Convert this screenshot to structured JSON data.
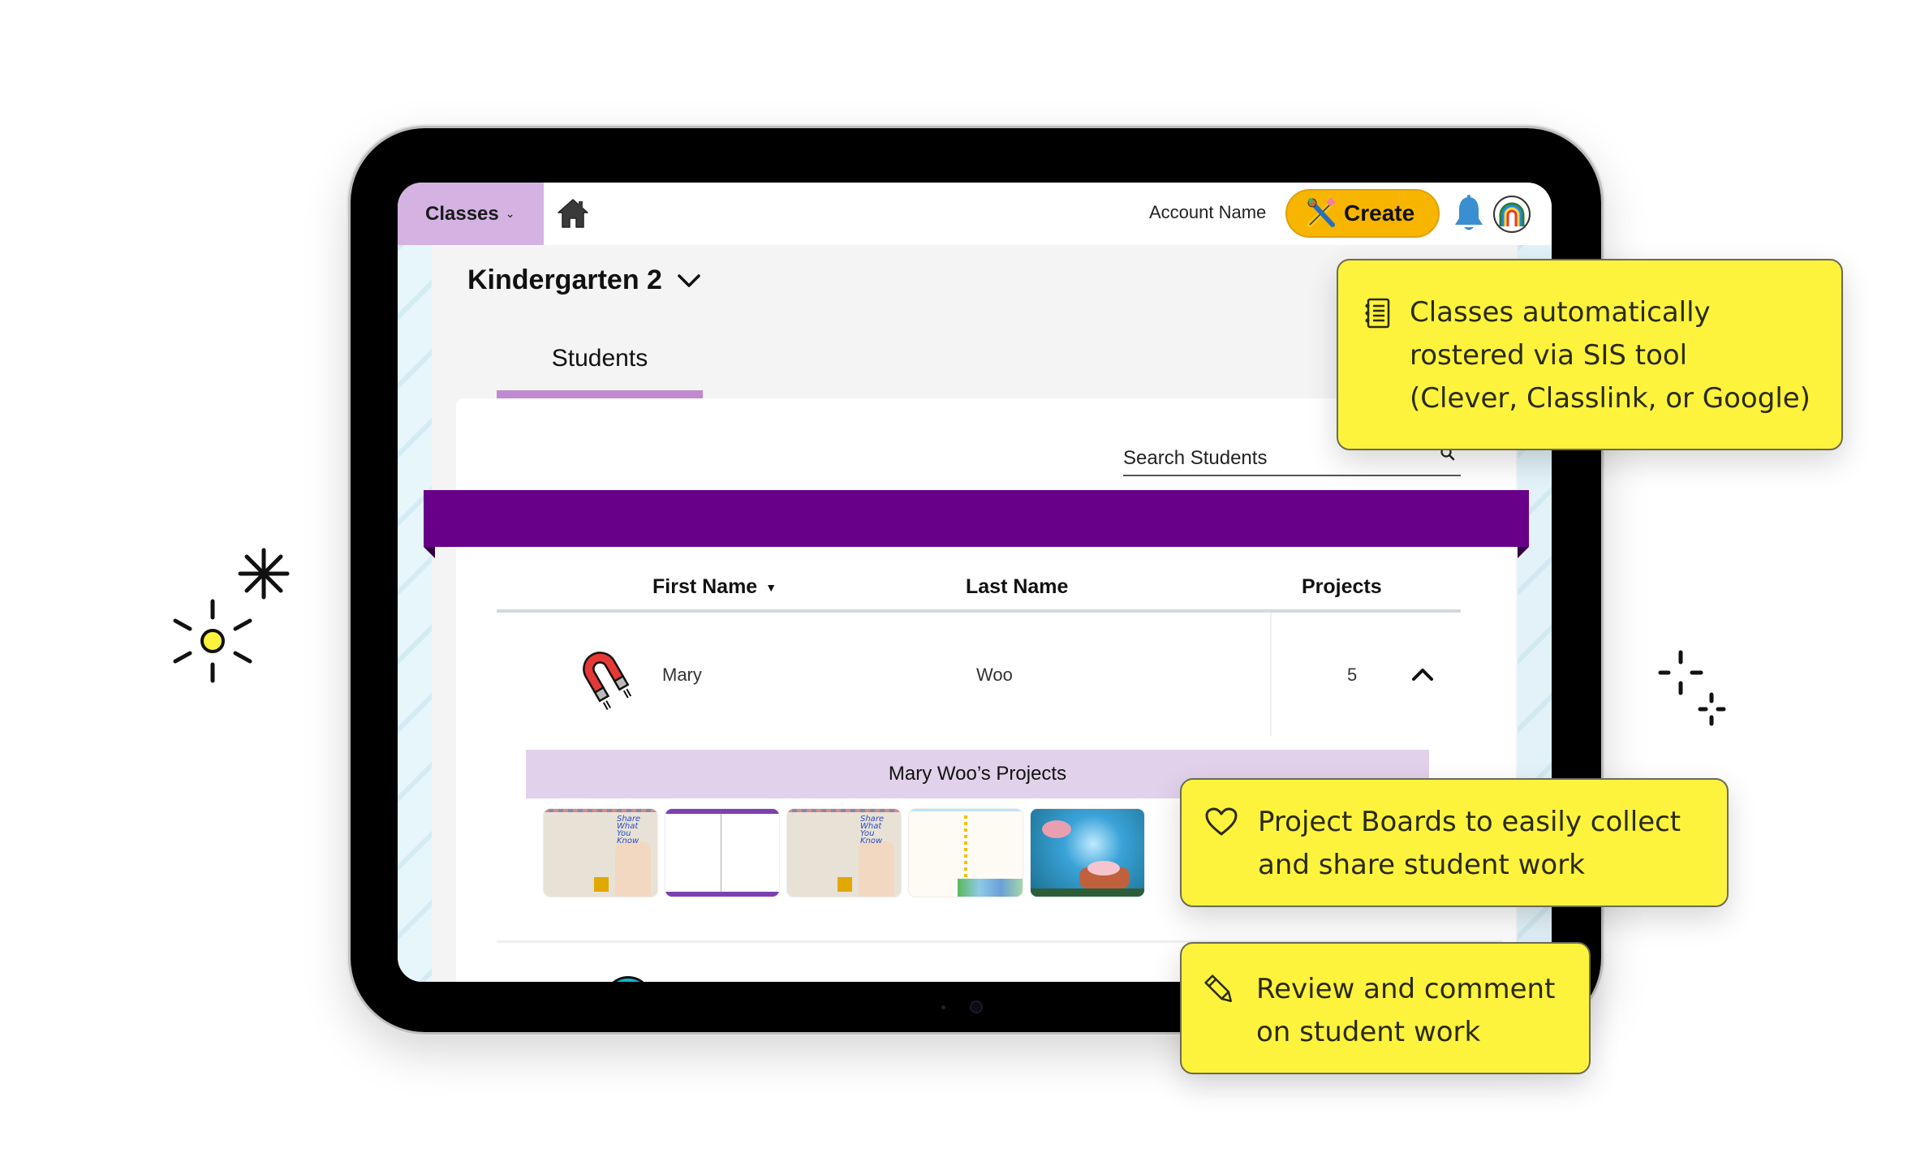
{
  "app": {
    "nav": {
      "classes_label": "Classes",
      "classes_chevron": "⌄",
      "home_icon": "home-icon",
      "account_name": "Account Name",
      "create_label": "Create",
      "create_icon": "paintbrush-pencil-icon",
      "notifications_icon": "bell-icon",
      "avatar_icon": "rainbow-avatar-icon"
    },
    "class_selector": {
      "title": "Kindergarten 2",
      "chevron_icon": "chevron-down-icon"
    },
    "tabs": [
      {
        "label": "Students",
        "active": true
      }
    ],
    "search": {
      "placeholder": "Search Students",
      "value": "",
      "icon": "search-icon"
    },
    "banner_color": "#690089",
    "table": {
      "columns": [
        {
          "label": "First Name",
          "sort": "descending"
        },
        {
          "label": "Last Name"
        },
        {
          "label": "Projects"
        }
      ],
      "rows": [
        {
          "avatar_icon": "magnet-icon",
          "first_name": "Mary",
          "last_name": "Woo",
          "projects": "5",
          "expanded": true,
          "expand_icon": "chevron-up-icon"
        }
      ]
    },
    "projects_panel": {
      "title": "Mary Woo’s Projects",
      "thumbnails": [
        {
          "name": "project-share-what-you-know-1",
          "theme": "beige"
        },
        {
          "name": "project-book-purple",
          "theme": "white-purple"
        },
        {
          "name": "project-share-what-you-know-2",
          "theme": "beige"
        },
        {
          "name": "project-city-notebook",
          "theme": "cream-city"
        },
        {
          "name": "project-axolotl-underwater",
          "theme": "ocean"
        }
      ]
    }
  },
  "callouts": [
    {
      "icon": "notebook-icon",
      "text": "Classes automatically\nrostered via SIS tool\n(Clever, Classlink, or Google)"
    },
    {
      "icon": "heart-icon",
      "text": "Project Boards to easily collect\nand share student work"
    },
    {
      "icon": "pencil-icon",
      "text": "Review and comment\non student work"
    }
  ],
  "colors": {
    "accent_purple": "#690089",
    "tab_lilac": "#d4b3e3",
    "tab_underline": "#c08ad0",
    "create_yellow": "#f7b500",
    "callout_yellow": "#fdf33d",
    "bell_blue": "#3a8fd0"
  }
}
